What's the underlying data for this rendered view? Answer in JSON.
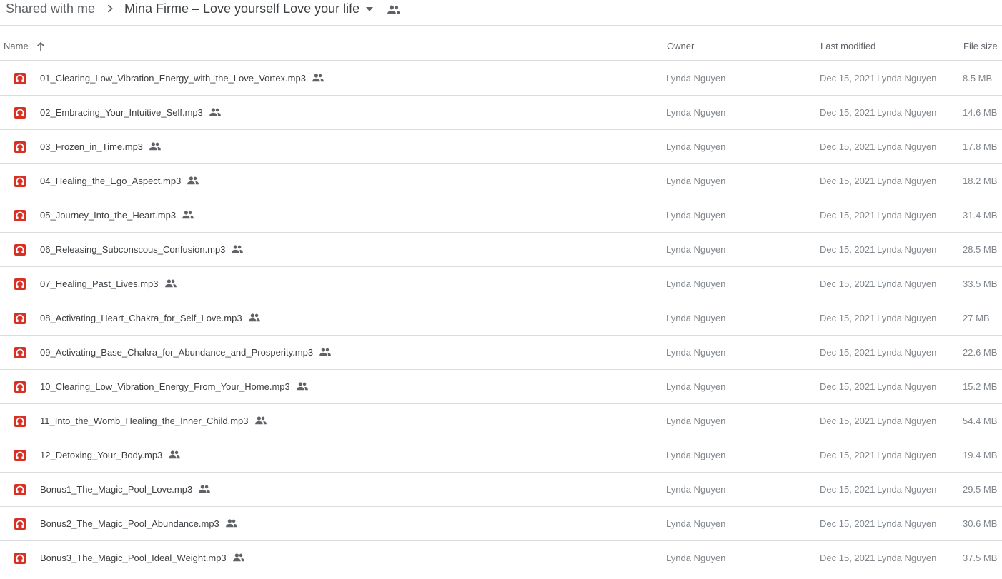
{
  "breadcrumb": {
    "parent": "Shared with me",
    "current": "Mina Firme – Love yourself Love your life"
  },
  "columns": {
    "name": "Name",
    "owner": "Owner",
    "last_modified": "Last modified",
    "file_size": "File size"
  },
  "icons": {
    "sort": "arrow-up-icon",
    "file": "audio-file-icon",
    "shared": "people-icon",
    "separator": "chevron-right-icon",
    "caret": "caret-down-icon"
  },
  "colors": {
    "audio_icon": "#d93025",
    "divider": "#dadce0",
    "muted_text": "#80868b"
  },
  "files": [
    {
      "name": "01_Clearing_Low_Vibration_Energy_with_the_Love_Vortex.mp3",
      "owner": "Lynda Nguyen",
      "date": "Dec 15, 2021",
      "modified_by": "Lynda Nguyen",
      "size": "8.5 MB"
    },
    {
      "name": "02_Embracing_Your_Intuitive_Self.mp3",
      "owner": "Lynda Nguyen",
      "date": "Dec 15, 2021",
      "modified_by": "Lynda Nguyen",
      "size": "14.6 MB"
    },
    {
      "name": "03_Frozen_in_Time.mp3",
      "owner": "Lynda Nguyen",
      "date": "Dec 15, 2021",
      "modified_by": "Lynda Nguyen",
      "size": "17.8 MB"
    },
    {
      "name": "04_Healing_the_Ego_Aspect.mp3",
      "owner": "Lynda Nguyen",
      "date": "Dec 15, 2021",
      "modified_by": "Lynda Nguyen",
      "size": "18.2 MB"
    },
    {
      "name": "05_Journey_Into_the_Heart.mp3",
      "owner": "Lynda Nguyen",
      "date": "Dec 15, 2021",
      "modified_by": "Lynda Nguyen",
      "size": "31.4 MB"
    },
    {
      "name": "06_Releasing_Subconscous_Confusion.mp3",
      "owner": "Lynda Nguyen",
      "date": "Dec 15, 2021",
      "modified_by": "Lynda Nguyen",
      "size": "28.5 MB"
    },
    {
      "name": "07_Healing_Past_Lives.mp3",
      "owner": "Lynda Nguyen",
      "date": "Dec 15, 2021",
      "modified_by": "Lynda Nguyen",
      "size": "33.5 MB"
    },
    {
      "name": "08_Activating_Heart_Chakra_for_Self_Love.mp3",
      "owner": "Lynda Nguyen",
      "date": "Dec 15, 2021",
      "modified_by": "Lynda Nguyen",
      "size": "27 MB"
    },
    {
      "name": "09_Activating_Base_Chakra_for_Abundance_and_Prosperity.mp3",
      "owner": "Lynda Nguyen",
      "date": "Dec 15, 2021",
      "modified_by": "Lynda Nguyen",
      "size": "22.6 MB"
    },
    {
      "name": "10_Clearing_Low_Vibration_Energy_From_Your_Home.mp3",
      "owner": "Lynda Nguyen",
      "date": "Dec 15, 2021",
      "modified_by": "Lynda Nguyen",
      "size": "15.2 MB"
    },
    {
      "name": "11_Into_the_Womb_Healing_the_Inner_Child.mp3",
      "owner": "Lynda Nguyen",
      "date": "Dec 15, 2021",
      "modified_by": "Lynda Nguyen",
      "size": "54.4 MB"
    },
    {
      "name": "12_Detoxing_Your_Body.mp3",
      "owner": "Lynda Nguyen",
      "date": "Dec 15, 2021",
      "modified_by": "Lynda Nguyen",
      "size": "19.4 MB"
    },
    {
      "name": "Bonus1_The_Magic_Pool_Love.mp3",
      "owner": "Lynda Nguyen",
      "date": "Dec 15, 2021",
      "modified_by": "Lynda Nguyen",
      "size": "29.5 MB"
    },
    {
      "name": "Bonus2_The_Magic_Pool_Abundance.mp3",
      "owner": "Lynda Nguyen",
      "date": "Dec 15, 2021",
      "modified_by": "Lynda Nguyen",
      "size": "30.6 MB"
    },
    {
      "name": "Bonus3_The_Magic_Pool_Ideal_Weight.mp3",
      "owner": "Lynda Nguyen",
      "date": "Dec 15, 2021",
      "modified_by": "Lynda Nguyen",
      "size": "37.5 MB"
    }
  ]
}
